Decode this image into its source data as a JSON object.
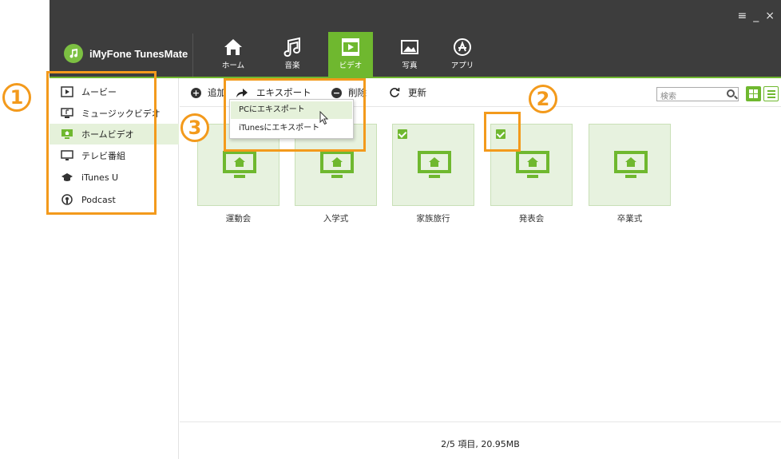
{
  "app": {
    "name": "iMyFone TunesMate"
  },
  "window_controls": [
    "≡",
    "_",
    "×"
  ],
  "nav_tabs": [
    {
      "label": "ホーム",
      "icon": "home-icon"
    },
    {
      "label": "音楽",
      "icon": "music-note-icon"
    },
    {
      "label": "ビデオ",
      "icon": "video-icon",
      "active": true
    },
    {
      "label": "写真",
      "icon": "photo-icon"
    },
    {
      "label": "アプリ",
      "icon": "app-store-icon"
    }
  ],
  "sidebar": {
    "items": [
      {
        "label": "ムービー",
        "icon": "movie-icon"
      },
      {
        "label": "ミュージックビデオ",
        "icon": "music-video-icon"
      },
      {
        "label": "ホームビデオ",
        "icon": "home-video-icon",
        "active": true
      },
      {
        "label": "テレビ番組",
        "icon": "tv-icon"
      },
      {
        "label": "iTunes U",
        "icon": "graduation-cap-icon"
      },
      {
        "label": "Podcast",
        "icon": "podcast-icon"
      }
    ]
  },
  "toolbar": {
    "add_label": "追加",
    "export_label": "エキスポート",
    "delete_label": "削除",
    "refresh_label": "更新",
    "search_placeholder": "検索"
  },
  "export_menu": {
    "items": [
      {
        "label": "PCにエキスポート",
        "hovered": true
      },
      {
        "label": "iTunesにエキスポート"
      }
    ]
  },
  "videos": [
    {
      "title": "運動会",
      "checked": false
    },
    {
      "title": "入学式",
      "checked": false
    },
    {
      "title": "家族旅行",
      "checked": true
    },
    {
      "title": "発表会",
      "checked": true
    },
    {
      "title": "卒業式",
      "checked": false
    }
  ],
  "status": {
    "text": "2/5 項目, 20.95MB"
  },
  "annotations": {
    "one": "1",
    "two": "2",
    "three": "3"
  },
  "colors": {
    "accent": "#6fb82f",
    "annotation": "#f39a1c",
    "titlebar": "#3d3d3d"
  }
}
